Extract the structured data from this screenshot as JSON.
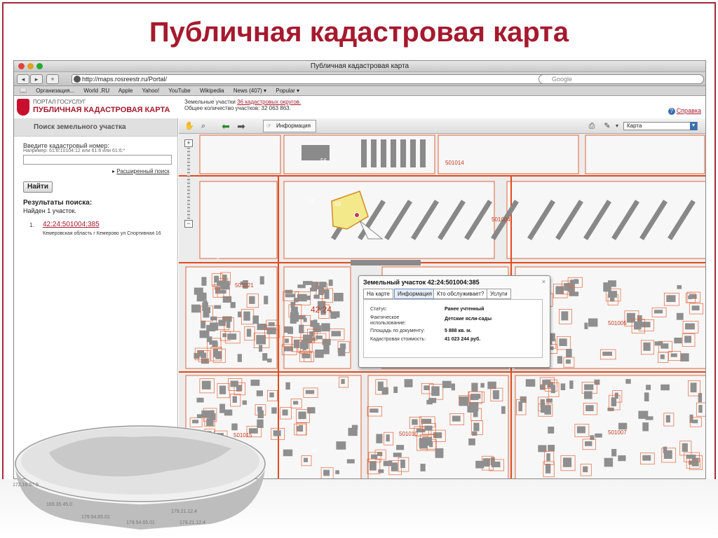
{
  "slide": {
    "title": "Публичная кадастровая карта"
  },
  "browser": {
    "window_title": "Публичная кадастровая карта",
    "url": "http://maps.rosreestr.ru/Portal/",
    "search_placeholder": "Google",
    "bookmarks": [
      "Организация...",
      "World .RU",
      "Apple",
      "Yahoo!",
      "YouTube",
      "Wikipedia",
      "News (407) ▾",
      "Popular ▾"
    ]
  },
  "portal": {
    "subtitle": "ПОРТАЛ ГОСУСЛУГ",
    "name": "ПУБЛИЧНАЯ КАДАСТРОВАЯ КАРТА",
    "stats_prefix": "Земельные участки",
    "stats_link": "36 кадастровых округов.",
    "stats_total": "Общее количество участков: 32 063 863.",
    "help": "Справка"
  },
  "search_panel": {
    "header": "Поиск земельного участка",
    "input_label": "Введите кадастровый номер:",
    "input_example": "Например: 61:6:10104:12 или 61:6 или 61:6:*",
    "input_value": "",
    "advanced_link": "Расширенный поиск",
    "find_button": "Найти",
    "results_title": "Результаты поиска:",
    "results_count": "Найден 1 участок.",
    "results": [
      {
        "number": "1.",
        "cad_number": "42:24:501004:385",
        "address": "Кемеровская область г Кемерово ул Спортивная 16"
      }
    ]
  },
  "map_toolbar": {
    "info_button": "Информация",
    "layer_select": "Карта"
  },
  "map": {
    "labels": [
      "501014",
      "501004",
      "501021",
      "42:24",
      "501005",
      "501015",
      "501010",
      "501007"
    ],
    "house_numbers": [
      "56",
      "59",
      "63",
      "2",
      "42"
    ]
  },
  "popup": {
    "title": "Земельный участок 42:24:501004:385",
    "close": "×",
    "tabs": [
      "На карте",
      "Информация",
      "Кто обслуживает?",
      "Услуги"
    ],
    "active_tab": "Информация",
    "fields": [
      {
        "key": "Статус:",
        "value": "Ранее учтенный"
      },
      {
        "key": "Фактическое использование:",
        "value": "Детские ясли-сады"
      },
      {
        "key": "Площадь по документу:",
        "value": "5 888 кв. м."
      },
      {
        "key": "Кадастровая стоимость:",
        "value": "41 023 244 руб."
      }
    ]
  },
  "decor": {
    "ips": [
      "172.18.57.5",
      "169.35.45.0",
      "179.54.65.01",
      "179.54.65.01",
      "179.21.12.4",
      "179.21.12.4"
    ]
  }
}
